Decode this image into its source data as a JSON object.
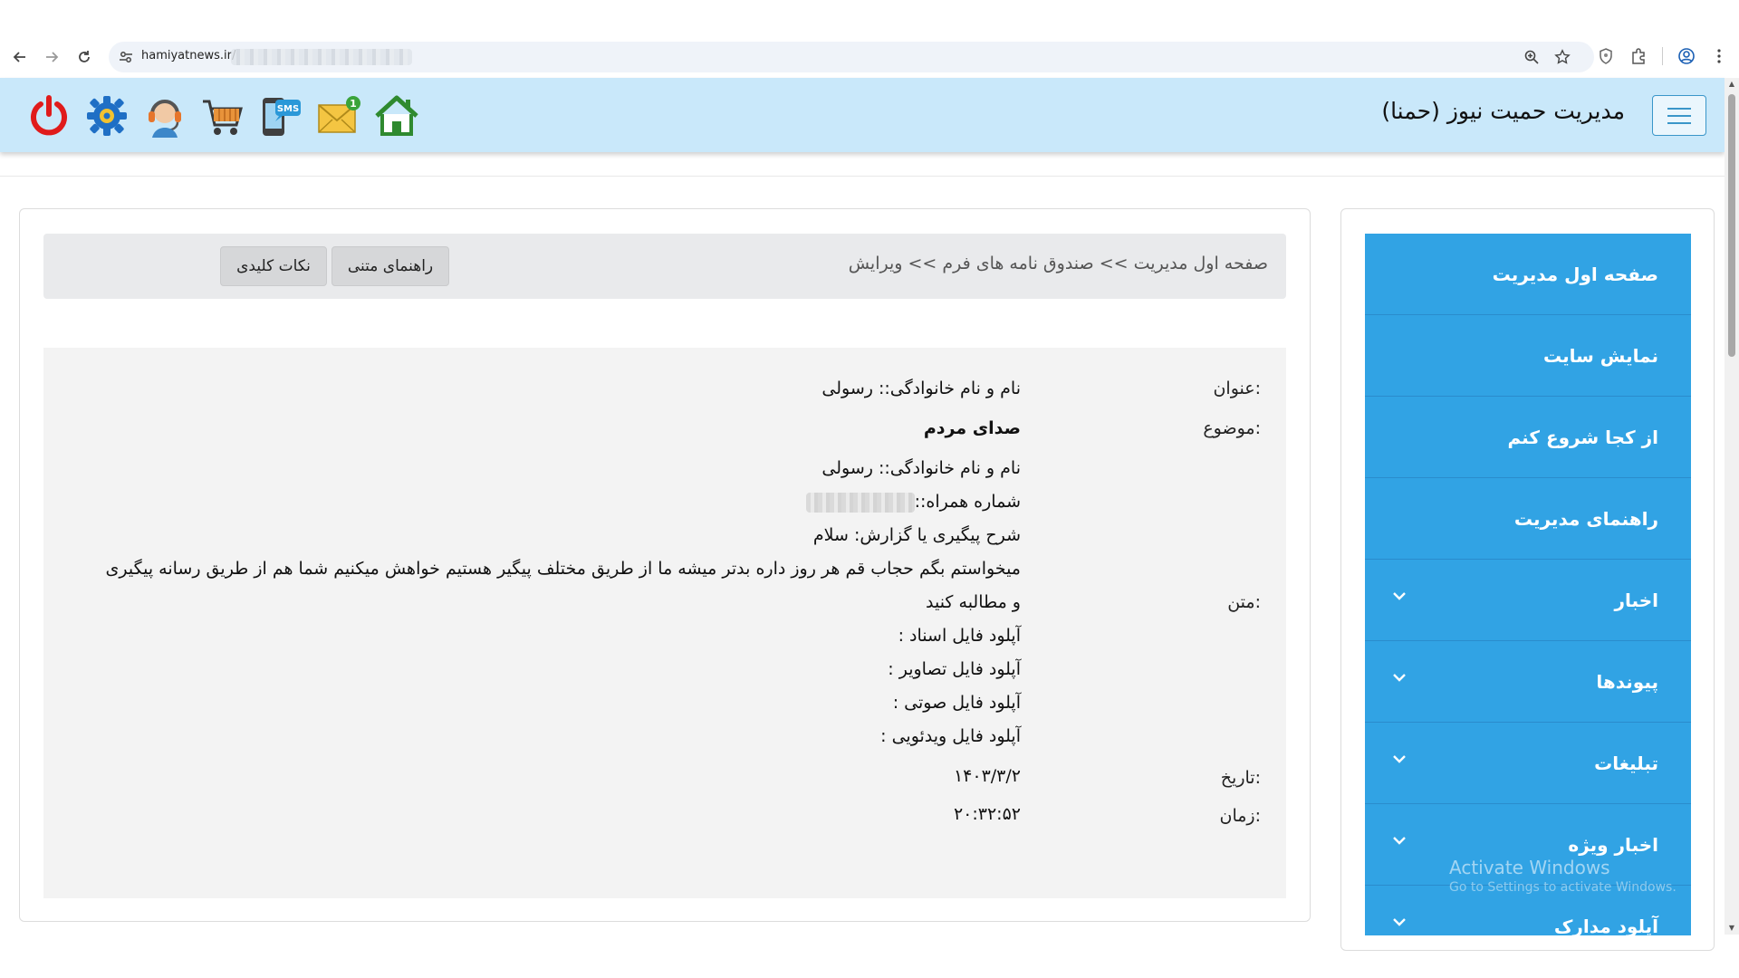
{
  "browser": {
    "url": "hamiyatnews.ir/"
  },
  "header": {
    "title": "مدیریت حمیت نیوز (حمنا)",
    "icons": [
      "home-icon",
      "mail-icon",
      "sms-phone-icon",
      "cart-icon",
      "support-headset-icon",
      "settings-gear-icon",
      "power-icon"
    ]
  },
  "breadcrumb": "صفحه اول مدیریت >> صندوق نامه های فرم >> ویرایش",
  "buttons": {
    "text_guide": "راهنمای متنی",
    "key_points": "نکات کلیدی"
  },
  "details": {
    "title_label": "عنوان:",
    "title_value": "نام و نام خانوادگی:: رسولی",
    "subject_label": "موضوع:",
    "subject_value": "صدای مردم",
    "body_label": "متن:",
    "body_lines": [
      "نام و نام خانوادگی:: رسولی",
      "شماره همراه::",
      "شرح پیگیری یا گزارش: سلام",
      "میخواستم بگم حجاب قم هر روز داره بدتر میشه ما از طریق مختلف پیگیر هستیم خواهش میکنیم شما هم از طریق رسانه پیگیری",
      "و مطالبه کنید",
      "آپلود فایل اسناد :",
      "آپلود فایل تصاویر :",
      "آپلود فایل صوتی :",
      "آپلود فایل ویدئویی :"
    ],
    "date_label": "تاریخ:",
    "date_value": "۱۴۰۳/۳/۲",
    "time_label": "زمان:",
    "time_value": "۲۰:۳۲:۵۲"
  },
  "sidebar": {
    "items": [
      {
        "label": "صفحه اول مدیریت",
        "has_submenu": false
      },
      {
        "label": "نمایش سایت",
        "has_submenu": false
      },
      {
        "label": "از کجا شروع کنم",
        "has_submenu": false
      },
      {
        "label": "راهنمای مدیریت",
        "has_submenu": false
      },
      {
        "label": "اخبار",
        "has_submenu": true
      },
      {
        "label": "پیوندها",
        "has_submenu": true
      },
      {
        "label": "تبلیغات",
        "has_submenu": true
      },
      {
        "label": "اخبار ویژه",
        "has_submenu": true
      },
      {
        "label": "آپلود مدارک",
        "has_submenu": true
      }
    ]
  },
  "watermark": {
    "line1": "Activate Windows",
    "line2": "Go to Settings to activate Windows."
  },
  "colors": {
    "header_bg": "#c9e8fa",
    "sidebar_item_bg": "#31a3e4",
    "breadcrumb_bg": "#e9eaec",
    "detail_bg": "#f3f3f3"
  }
}
